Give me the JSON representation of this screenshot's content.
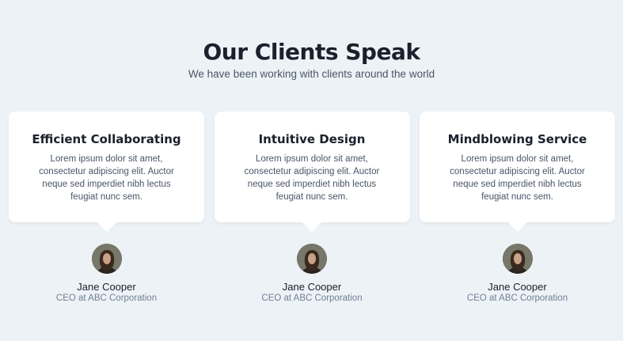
{
  "header": {
    "title": "Our Clients Speak",
    "subtitle": "We have been working with clients around the world"
  },
  "testimonials": [
    {
      "title": "Efficient Collaborating",
      "text": "Lorem ipsum dolor sit amet, consectetur adipiscing elit. Auctor neque sed imperdiet nibh lectus feugiat nunc sem.",
      "name": "Jane Cooper",
      "role": "CEO at ABC Corporation",
      "avatar_icon": "person-photo"
    },
    {
      "title": "Intuitive Design",
      "text": "Lorem ipsum dolor sit amet, consectetur adipiscing elit. Auctor neque sed imperdiet nibh lectus feugiat nunc sem.",
      "name": "Jane Cooper",
      "role": "CEO at ABC Corporation",
      "avatar_icon": "person-photo"
    },
    {
      "title": "Mindblowing Service",
      "text": "Lorem ipsum dolor sit amet, consectetur adipiscing elit. Auctor neque sed imperdiet nibh lectus feugiat nunc sem.",
      "name": "Jane Cooper",
      "role": "CEO at ABC Corporation",
      "avatar_icon": "person-photo"
    }
  ],
  "colors": {
    "background": "#edf2f7",
    "card": "#ffffff",
    "heading": "#1a202c",
    "body_text": "#4a5568",
    "muted": "#718096"
  }
}
